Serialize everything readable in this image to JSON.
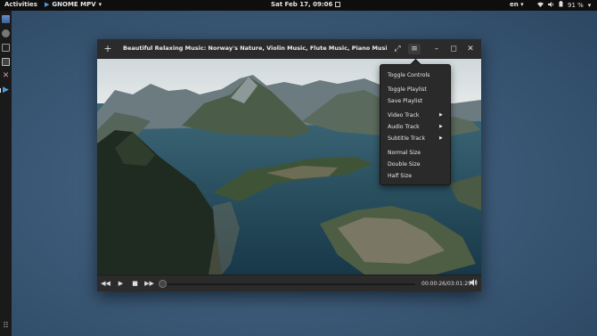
{
  "topbar": {
    "activities": "Activities",
    "app_name": "GNOME MPV",
    "app_arrow": "▾",
    "clock": "Sat Feb 17, 09:06",
    "lang": "en",
    "lang_arrow": "▾",
    "battery": "91 %",
    "power_arrow": "▾"
  },
  "dock": {
    "items": [
      "files-icon",
      "settings-icon",
      "terminal-icon",
      "text-editor-icon",
      "tools-icon",
      "gnome-mpv-icon",
      "app-grid-icon"
    ]
  },
  "window": {
    "add_label": "+",
    "title": "Beautiful Relaxing Music: Norway's Nature, Violin Music, Flute Music, Piano Music, Harp Musi...",
    "fullscreen_glyph": "⤢",
    "menu_glyph": "≡",
    "minimize_glyph": "–",
    "maximize_glyph": "◻",
    "close_glyph": "✕"
  },
  "menu": {
    "items": [
      {
        "label": "Toggle Controls",
        "has_submenu": false
      },
      {
        "label": "Toggle Playlist",
        "has_submenu": false
      },
      {
        "label": "Save Playlist",
        "has_submenu": false
      },
      {
        "label": "Video Track",
        "has_submenu": true
      },
      {
        "label": "Audio Track",
        "has_submenu": true
      },
      {
        "label": "Subtitle Track",
        "has_submenu": true
      },
      {
        "label": "Normal Size",
        "has_submenu": false
      },
      {
        "label": "Double Size",
        "has_submenu": false
      },
      {
        "label": "Half Size",
        "has_submenu": false
      }
    ],
    "submenu_arrow": "▶"
  },
  "controls": {
    "rewind_glyph": "◀◀",
    "play_glyph": "▶",
    "stop_glyph": "■",
    "forward_glyph": "▶▶",
    "time": "00:00:26/03:01:29",
    "volume_glyph": "🔊",
    "progress_fraction": 0.0024
  },
  "colors": {
    "accent": "#4a9ee0",
    "panel": "#0e0e0e",
    "window": "#2b2b2b"
  }
}
